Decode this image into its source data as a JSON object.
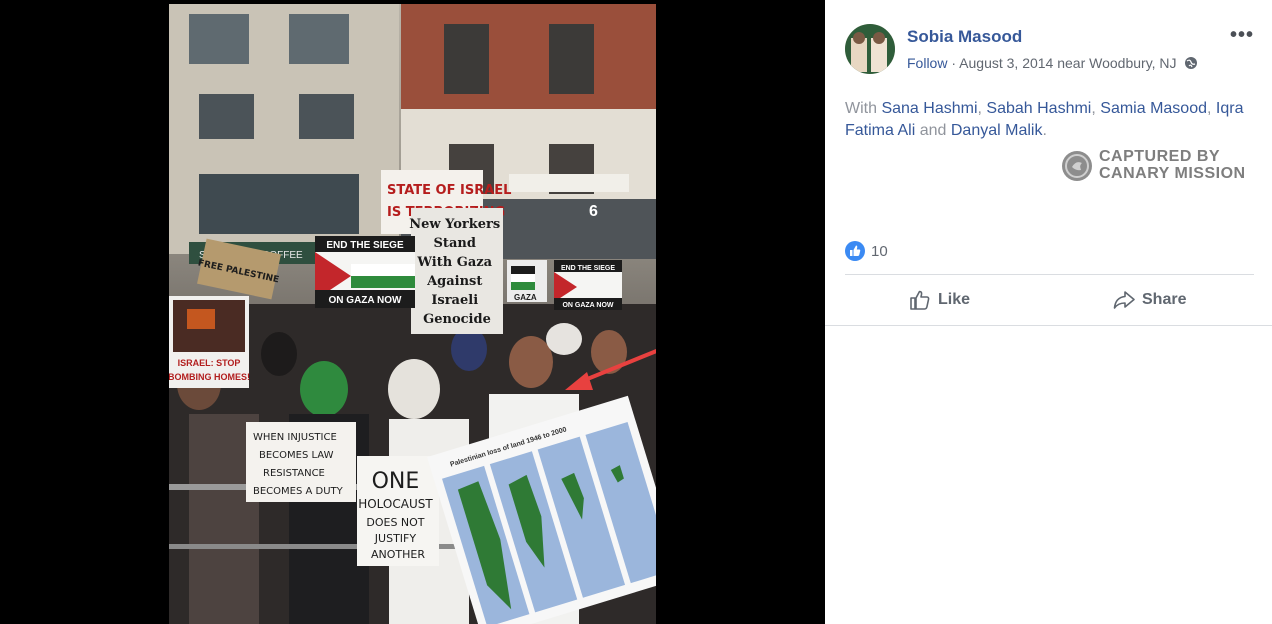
{
  "post": {
    "author": "Sobia Masood",
    "follow_label": "Follow",
    "separator": "·",
    "date_location": "August 3, 2014 near Woodbury, NJ",
    "privacy_icon": "globe-icon",
    "more_label": "•••",
    "with_prefix": "With",
    "tagged": [
      "Sana Hashmi",
      "Sabah Hashmi",
      "Samia Masood",
      "Iqra Fatima Ali",
      "Danyal Malik"
    ],
    "comma": ",",
    "and_word": "and",
    "period": ".",
    "watermark_line1": "CAPTURED BY",
    "watermark_line2": "CANARY MISSION",
    "reaction_count": "10",
    "like_label": "Like",
    "share_label": "Share"
  },
  "photo_signs": {
    "sign1_line1": "STATE OF ISRAEL",
    "sign1_line2": "IS TERRORIZING",
    "sign2": [
      "New Yorkers",
      "Stand",
      "With Gaza",
      "Against",
      "Israeli",
      "Genocide"
    ],
    "sign3_top": "END THE SIEGE",
    "sign3_bottom": "ON GAZA NOW",
    "sign4_top": "END THE SIEGE",
    "sign4_bottom": "ON GAZA NOW",
    "sign5": "FREE PALESTINE",
    "sign6_line1": "ISRAEL: STOP",
    "sign6_line2": "BOMBING HOMES!",
    "sign7": [
      "WHEN INJUSTICE",
      "BECOMES LAW",
      "RESISTANCE",
      "BECOMES A DUTY"
    ],
    "sign8": [
      "ONE",
      "HOLOCAUST",
      "DOES NOT",
      "JUSTIFY",
      "ANOTHER"
    ],
    "map_title": "Palestinian loss of land 1946 to 2000",
    "storefront": "STARBUCKS COFFEE",
    "address": "6",
    "gaza_label": "GAZA"
  },
  "colors": {
    "link": "#365899",
    "meta": "#616770",
    "like_blue": "#3b8af3",
    "annotation_arrow": "#e8413f"
  }
}
